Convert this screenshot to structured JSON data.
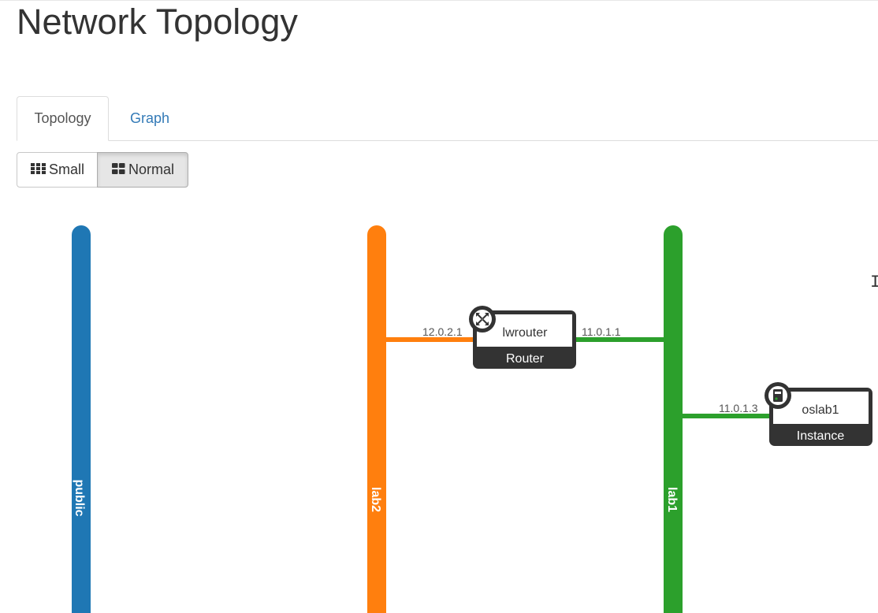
{
  "page": {
    "title": "Network Topology"
  },
  "tabs": [
    {
      "label": "Topology",
      "active": true
    },
    {
      "label": "Graph",
      "active": false
    }
  ],
  "size_toggle": {
    "small_label": "Small",
    "normal_label": "Normal",
    "selected": "Normal"
  },
  "colors": {
    "public": "#1f77b4",
    "lab2": "#ff7f0e",
    "lab1": "#2ca02c",
    "node_dark": "#333333",
    "link_blue": "#337ab7"
  },
  "topology": {
    "networks": [
      {
        "name": "public",
        "color": "#1f77b4"
      },
      {
        "name": "lab2",
        "color": "#ff7f0e"
      },
      {
        "name": "lab1",
        "color": "#2ca02c"
      }
    ],
    "router": {
      "name": "lwrouter",
      "type": "Router",
      "icon": "router-arrows-icon",
      "ports": [
        {
          "network": "lab2",
          "ip": "12.0.2.1"
        },
        {
          "network": "lab1",
          "ip": "11.0.1.1"
        }
      ]
    },
    "instance": {
      "name": "oslab1",
      "type": "Instance",
      "icon": "server-icon",
      "ports": [
        {
          "network": "lab1",
          "ip": "11.0.1.3"
        }
      ]
    }
  }
}
